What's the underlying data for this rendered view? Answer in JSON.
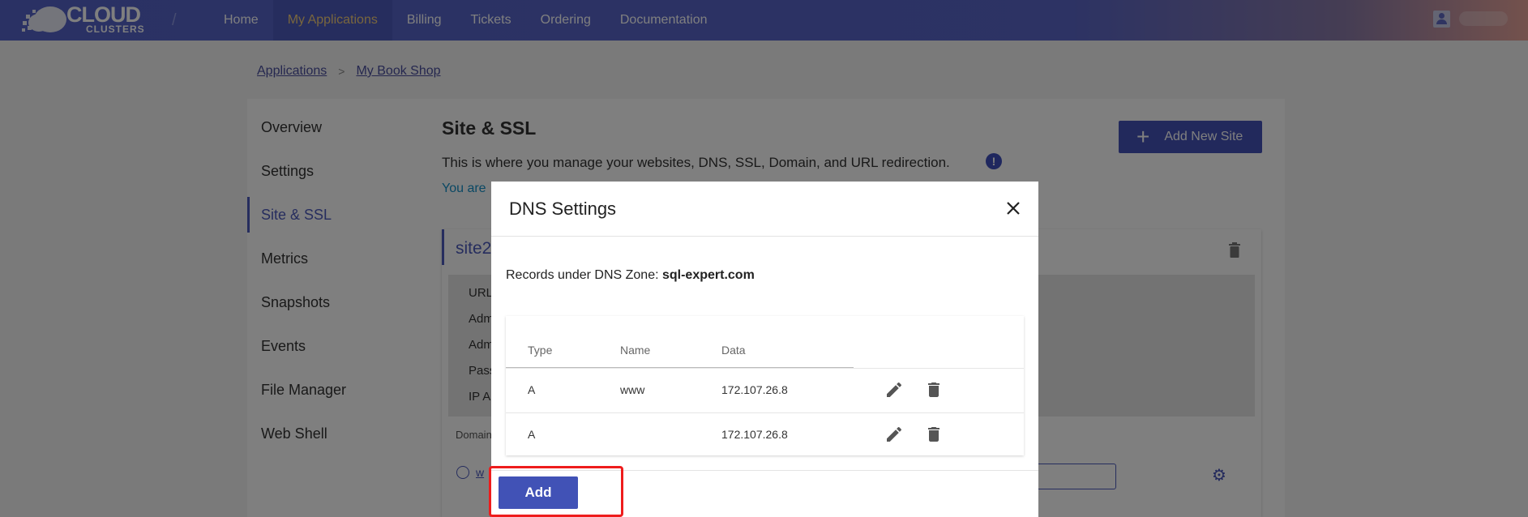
{
  "header": {
    "logo_line1": "CLOUD",
    "logo_line2": "CLUSTERS",
    "nav": [
      {
        "label": "Home"
      },
      {
        "label": "My Applications"
      },
      {
        "label": "Billing"
      },
      {
        "label": "Tickets"
      },
      {
        "label": "Ordering"
      },
      {
        "label": "Documentation"
      }
    ]
  },
  "breadcrumb": {
    "items": [
      "Applications",
      "My Book Shop"
    ],
    "separator": ">"
  },
  "sidebar": {
    "items": [
      {
        "label": "Overview"
      },
      {
        "label": "Settings"
      },
      {
        "label": "Site & SSL"
      },
      {
        "label": "Metrics"
      },
      {
        "label": "Snapshots"
      },
      {
        "label": "Events"
      },
      {
        "label": "File Manager"
      },
      {
        "label": "Web Shell"
      }
    ],
    "active": "Site & SSL"
  },
  "main": {
    "title": "Site & SSL",
    "description": "This is where you manage your websites, DNS, SSL, Domain, and URL redirection.",
    "note": "You are",
    "add_site_label": "Add New Site",
    "site_name": "site2",
    "info_labels": [
      "URL",
      "Adm",
      "Adm",
      "Pass",
      "IP A"
    ],
    "domain_label": "Domain",
    "link_text": "w"
  },
  "modal": {
    "title": "DNS Settings",
    "zone_prefix": "Records under DNS Zone:",
    "zone_name": "sql-expert.com",
    "columns": [
      "Type",
      "Name",
      "Data"
    ],
    "rows": [
      {
        "type": "A",
        "name": "www",
        "data": "172.107.26.8"
      },
      {
        "type": "A",
        "name": "",
        "data": "172.107.26.8"
      }
    ],
    "add_label": "Add"
  },
  "colors": {
    "primary": "#4553b8",
    "active_nav_text": "#f2cc7b",
    "highlight_border": "#ee1c1c"
  }
}
